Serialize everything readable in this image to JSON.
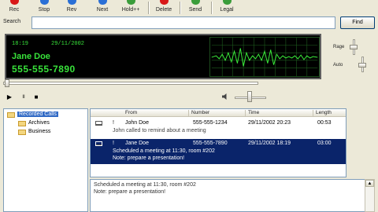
{
  "toolbar": {
    "buttons": [
      {
        "label": "Rec",
        "icon": "record-icon",
        "color": "#d81818"
      },
      {
        "label": "Stop",
        "icon": "stop-icon",
        "color": "#2a6fd6"
      },
      {
        "label": "Rev",
        "icon": "rewind-icon",
        "color": "#2a6fd6"
      },
      {
        "label": "Next",
        "icon": "next-icon",
        "color": "#2a6fd6"
      },
      {
        "label": "Hold++",
        "icon": "hold-icon",
        "color": "#3a9d3a"
      },
      {
        "label": "Delete",
        "icon": "delete-icon",
        "color": "#d81818"
      },
      {
        "label": "Send",
        "icon": "send-icon",
        "color": "#3a9d3a"
      },
      {
        "label": "Legal",
        "icon": "legal-icon",
        "color": "#3a9d3a"
      }
    ]
  },
  "search": {
    "label": "Search",
    "value": "",
    "button": "Find"
  },
  "display": {
    "date": "18:19",
    "time": "29/11/2002",
    "name": "Jane Doe",
    "number": "555-555-7890",
    "text_color": "#38e23a"
  },
  "volume": {
    "top_label": "Rage",
    "bottom_label": "Auto"
  },
  "transport": {
    "play": "▶",
    "pause": "II",
    "stop": "■"
  },
  "tree": {
    "items": [
      {
        "label": "Recorded Calls",
        "level": 0,
        "selected": true
      },
      {
        "label": "Archives",
        "level": 1,
        "selected": false
      },
      {
        "label": "Business",
        "level": 1,
        "selected": false
      }
    ]
  },
  "list": {
    "columns": [
      "From",
      "Number",
      "Time",
      "Length"
    ],
    "rows": [
      {
        "flag": "!",
        "from": "John Doe",
        "number": "555-555-1234",
        "time": "29/11/2002 20:23",
        "length": "00:53",
        "note": "John called to remind about a meeting",
        "selected": false
      },
      {
        "flag": "!",
        "from": "Jane Doe",
        "number": "555-555-7890",
        "time": "29/11/2002 18:19",
        "length": "03:00",
        "note": "Scheduled a meeting at 11:30, room #202",
        "note2": "Note: prepare a presentation!",
        "selected": true
      }
    ]
  },
  "notes": {
    "lines": [
      "Scheduled a meeting at 11:30, room #202",
      "Note: prepare a presentation!"
    ]
  }
}
